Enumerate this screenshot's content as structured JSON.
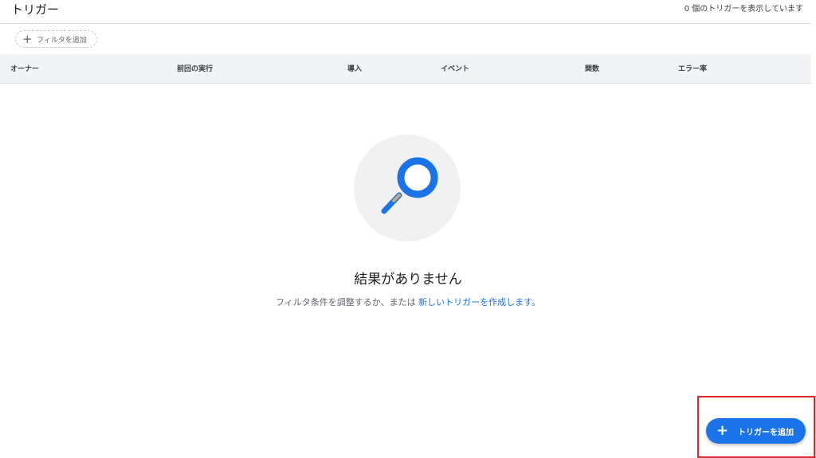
{
  "header": {
    "title": "トリガー",
    "count_text": "0 個のトリガーを表示しています"
  },
  "filter": {
    "add_label": "フィルタを追加",
    "icon": "plus-icon"
  },
  "table": {
    "columns": [
      "オーナー",
      "前回の実行",
      "導入",
      "イベント",
      "関数",
      "エラー率"
    ]
  },
  "empty_state": {
    "icon": "magnifier-icon",
    "title": "結果がありません",
    "description_prefix": "フィルタ条件を調整するか、または",
    "link_text": "新しいトリガーを作成します。"
  },
  "fab": {
    "label": "トリガーを追加",
    "icon": "plus-icon"
  },
  "colors": {
    "accent": "#1a73e8",
    "highlight": "#e0262b",
    "header_bg": "#f1f3f4"
  }
}
